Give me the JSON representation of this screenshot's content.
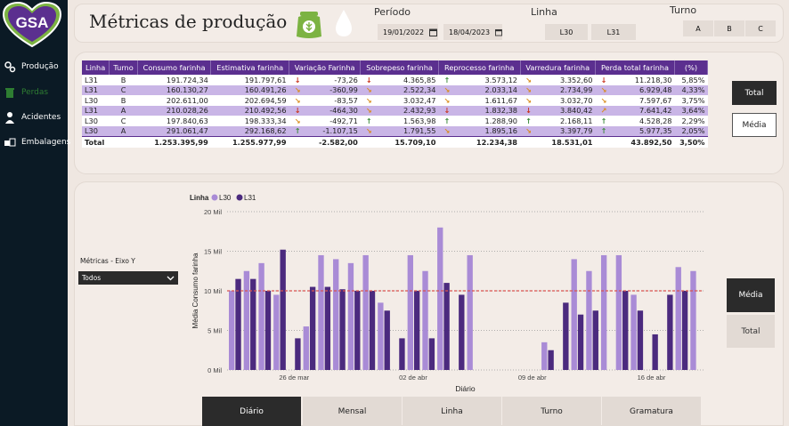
{
  "logo_text": "GSA",
  "nav": [
    {
      "label": "Produção",
      "icon": "gears-icon",
      "active": false
    },
    {
      "label": "Perdas",
      "icon": "trash-icon",
      "active": true
    },
    {
      "label": "Acidentes",
      "icon": "worker-icon",
      "active": false
    },
    {
      "label": "Embalagens",
      "icon": "boxes-icon",
      "active": false
    }
  ],
  "header": {
    "title": "Métricas de produção",
    "period_label": "Período",
    "date_start": "19/01/2022",
    "date_end": "18/04/2023",
    "linha_label": "Linha",
    "linha_options": [
      "L30",
      "L31"
    ],
    "turno_label": "Turno",
    "turno_options": [
      "A",
      "B",
      "C"
    ]
  },
  "table": {
    "headers": [
      "Linha",
      "Turno",
      "Consumo farinha",
      "Estimativa farinha",
      "Variação Farinha",
      "Sobrepeso farinha",
      "Reprocesso farinha",
      "Varredura farinha",
      "Perda total farinha",
      "(%)"
    ],
    "rows": [
      {
        "linha": "L31",
        "turno": "B",
        "consumo": "191.724,34",
        "estimativa": "191.797,61",
        "variacao": "-73,26",
        "var_arrow": "down",
        "sobrepeso": "4.365,85",
        "sob_arrow": "down",
        "reprocesso": "3.573,12",
        "rep_arrow": "up",
        "varredura": "3.352,60",
        "varr_arrow": "se",
        "perda": "11.218,30",
        "perda_arrow": "down",
        "pct": "5,85%"
      },
      {
        "linha": "L31",
        "turno": "C",
        "consumo": "160.130,27",
        "estimativa": "160.491,26",
        "variacao": "-360,99",
        "var_arrow": "se",
        "sobrepeso": "2.522,34",
        "sob_arrow": "se",
        "reprocesso": "2.033,14",
        "rep_arrow": "se",
        "varredura": "2.734,99",
        "varr_arrow": "se",
        "perda": "6.929,48",
        "perda_arrow": "se",
        "pct": "4,33%"
      },
      {
        "linha": "L30",
        "turno": "B",
        "consumo": "202.611,00",
        "estimativa": "202.694,59",
        "variacao": "-83,57",
        "var_arrow": "se",
        "sobrepeso": "3.032,47",
        "sob_arrow": "se",
        "reprocesso": "1.611,67",
        "rep_arrow": "se",
        "varredura": "3.032,70",
        "varr_arrow": "se",
        "perda": "7.597,67",
        "perda_arrow": "se",
        "pct": "3,75%"
      },
      {
        "linha": "L31",
        "turno": "A",
        "consumo": "210.028,26",
        "estimativa": "210.492,56",
        "variacao": "-464,30",
        "var_arrow": "down",
        "sobrepeso": "2.432,93",
        "sob_arrow": "se",
        "reprocesso": "1.832,38",
        "rep_arrow": "down",
        "varredura": "3.840,42",
        "varr_arrow": "down",
        "perda": "7.641,42",
        "perda_arrow": "ne",
        "pct": "3,64%"
      },
      {
        "linha": "L30",
        "turno": "C",
        "consumo": "197.840,63",
        "estimativa": "198.333,34",
        "variacao": "-492,71",
        "var_arrow": "se",
        "sobrepeso": "1.563,98",
        "sob_arrow": "up",
        "reprocesso": "1.288,90",
        "rep_arrow": "up",
        "varredura": "2.168,11",
        "varr_arrow": "up",
        "perda": "4.528,28",
        "perda_arrow": "up",
        "pct": "2,29%"
      },
      {
        "linha": "L30",
        "turno": "A",
        "consumo": "291.061,47",
        "estimativa": "292.168,62",
        "variacao": "-1.107,15",
        "var_arrow": "up",
        "sobrepeso": "1.791,55",
        "sob_arrow": "se",
        "reprocesso": "1.895,16",
        "rep_arrow": "se",
        "varredura": "3.397,79",
        "varr_arrow": "se",
        "perda": "5.977,35",
        "perda_arrow": "up",
        "pct": "2,05%"
      }
    ],
    "total": {
      "label": "Total",
      "consumo": "1.253.395,99",
      "estimativa": "1.255.977,99",
      "variacao": "-2.582,00",
      "sobrepeso": "15.709,10",
      "reprocesso": "12.234,38",
      "varredura": "18.531,01",
      "perda": "43.892,50",
      "pct": "3,50%"
    },
    "buttons": {
      "total": "Total",
      "media": "Média"
    }
  },
  "chart_controls": {
    "metric_label": "Métricas - Eixo Y",
    "metric_value": "Todos",
    "buttons": {
      "media": "Média",
      "total": "Total"
    },
    "tabs": [
      "Diário",
      "Mensal",
      "Linha",
      "Turno",
      "Gramatura"
    ]
  },
  "colors": {
    "l30": "#a98bd6",
    "l31": "#4b2a7e",
    "avg_line": "#d9534f",
    "header_purple": "#5b2f8f"
  },
  "chart_data": {
    "type": "bar",
    "legend_title": "Linha",
    "legend_position": "top-left",
    "xlabel": "Diário",
    "ylabel": "Média Consumo farinha",
    "ylim": [
      0,
      20000
    ],
    "yticks": [
      "0 Mil",
      "5 Mil",
      "10 Mil",
      "15 Mil",
      "20 Mil"
    ],
    "xtick_labels": [
      "26 de mar",
      "02 de abr",
      "09 de abr",
      "16 de abr"
    ],
    "reference_line": 10000,
    "series": [
      {
        "name": "L30",
        "values": [
          10000,
          12500,
          13500,
          9500,
          0,
          5500,
          14500,
          14000,
          13500,
          14500,
          8500,
          0,
          14500,
          12500,
          18000,
          0,
          14500,
          0,
          0,
          0,
          0,
          3500,
          0,
          14000,
          12500,
          14500,
          14500,
          9500,
          0,
          0,
          13000,
          12500
        ]
      },
      {
        "name": "L31",
        "values": [
          11500,
          11500,
          10000,
          15200,
          4000,
          10500,
          10500,
          10200,
          10000,
          10000,
          7500,
          4000,
          10000,
          4000,
          11000,
          9500,
          0,
          0,
          0,
          0,
          0,
          2500,
          8500,
          7000,
          7500,
          0,
          10000,
          7500,
          4500,
          9500,
          10000,
          0
        ]
      }
    ]
  }
}
